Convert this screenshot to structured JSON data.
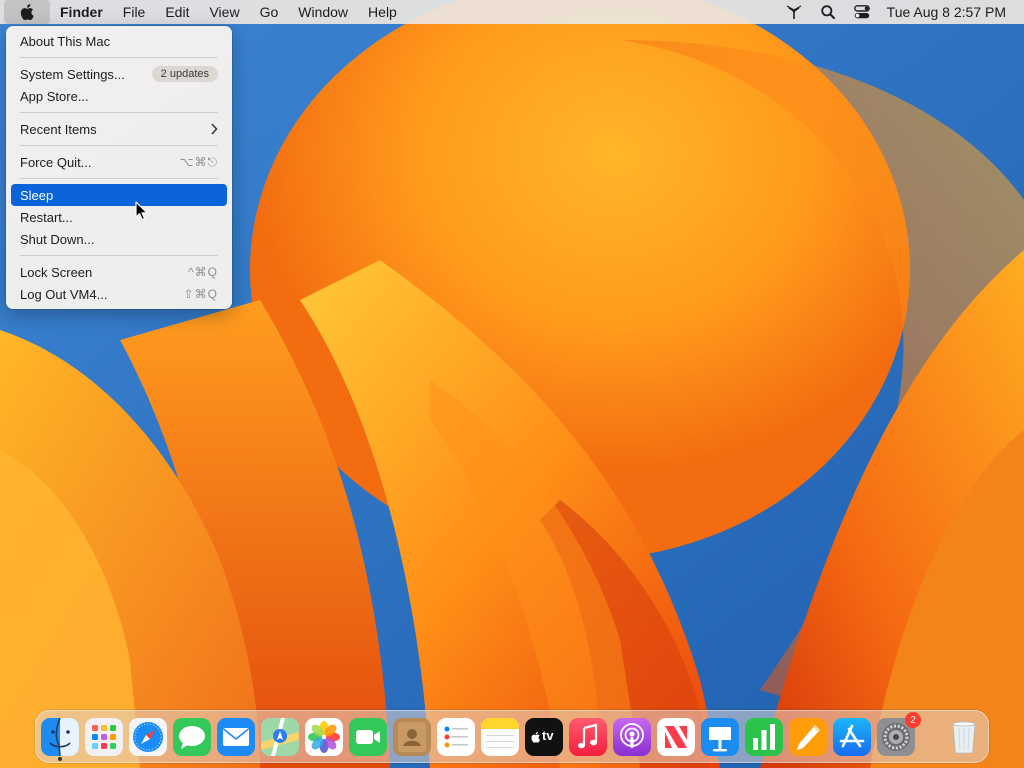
{
  "menubar": {
    "app_name": "Finder",
    "menus": [
      "File",
      "Edit",
      "View",
      "Go",
      "Window",
      "Help"
    ],
    "status_icons": [
      "airdrop-icon",
      "search-icon",
      "control-center-icon"
    ],
    "clock": "Tue Aug 8  2:57 PM"
  },
  "apple_menu": {
    "about": "About This Mac",
    "system_settings": "System Settings...",
    "updates_badge": "2 updates",
    "app_store": "App Store...",
    "recent_items": "Recent Items",
    "force_quit": "Force Quit...",
    "force_quit_shortcut": "⌥⌘⎋",
    "sleep": "Sleep",
    "restart": "Restart...",
    "shut_down": "Shut Down...",
    "lock_screen": "Lock Screen",
    "lock_screen_shortcut": "^⌘Q",
    "log_out": "Log Out VM4...",
    "log_out_shortcut": "⇧⌘Q",
    "highlight_color": "#0a63d8"
  },
  "dock": {
    "items": [
      {
        "name": "finder-icon"
      },
      {
        "name": "launchpad-icon"
      },
      {
        "name": "safari-icon"
      },
      {
        "name": "messages-icon"
      },
      {
        "name": "mail-icon"
      },
      {
        "name": "maps-icon"
      },
      {
        "name": "photos-icon"
      },
      {
        "name": "facetime-icon"
      },
      {
        "name": "contacts-icon"
      },
      {
        "name": "reminders-icon"
      },
      {
        "name": "notes-icon"
      },
      {
        "name": "apple-tv-icon"
      },
      {
        "name": "music-icon"
      },
      {
        "name": "podcasts-icon"
      },
      {
        "name": "news-icon"
      },
      {
        "name": "keynote-icon"
      },
      {
        "name": "numbers-icon"
      },
      {
        "name": "pages-icon"
      },
      {
        "name": "app-store-icon"
      },
      {
        "name": "system-settings-icon"
      },
      {
        "name": "trash-icon"
      }
    ],
    "tv_label": "tv",
    "settings_badge": "2"
  }
}
